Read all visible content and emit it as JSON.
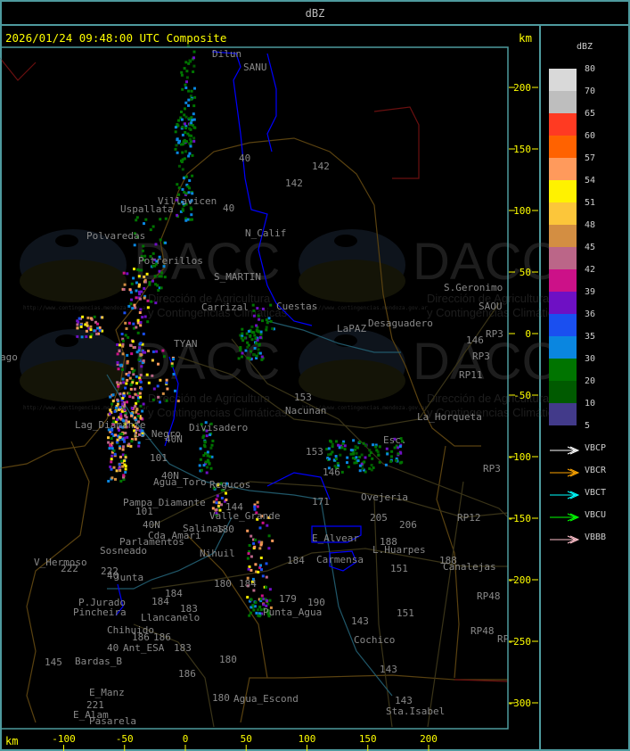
{
  "header": {
    "title": "dBZ"
  },
  "map": {
    "timestamp_title": "2026/01/24 09:48:00 UTC Composite",
    "unit_label_top": "km",
    "unit_label_bottom": "km",
    "x_axis_ticks": [
      "-100",
      "-50",
      "0",
      "50",
      "100",
      "150",
      "200"
    ],
    "y_axis_ticks": [
      "200",
      "150",
      "100",
      "50",
      "0",
      "-50",
      "-100",
      "-150",
      "-200",
      "-250",
      "-300"
    ],
    "place_labels": [
      "Dilun",
      "SANU",
      "40",
      "142",
      "142",
      "Villavicen",
      "40",
      "Uspallata",
      "N_Calif",
      "Polvaredas",
      "Potrerillos",
      "S_MARTIN",
      "Carrizal",
      "Cuestas",
      "LaPAZ",
      "Desaguadero",
      "S.Geronimo",
      "SAOU",
      "146",
      "RP3",
      "RP3",
      "RP11",
      "TYAN",
      "ago",
      "153",
      "Nacunan",
      "La_Horqueta",
      "Lag_Diamante",
      "Co_Negro",
      "Divisadero",
      "40N",
      "Esc.",
      "153",
      "146",
      "101",
      "40N",
      "Agua_Toro",
      "Regucos",
      "171",
      "Ovejeria",
      "205",
      "206",
      "Pampa_Diamante",
      "101",
      "144",
      "Valle_Grande",
      "40N",
      "Salinas",
      "180",
      "Cda_Amari",
      "Parlamentos",
      "Sosneado",
      "Nihuil",
      "E_Alvear",
      "188",
      "L.Huarpes",
      "Carmensa",
      "184",
      "188",
      "Canalejas",
      "RP12",
      "RP3",
      "V_Hermoso",
      "222",
      "222",
      "Junta",
      "40",
      "180",
      "184",
      "184",
      "190",
      "151",
      "P.Jurado",
      "Pincheira",
      "184",
      "Llancanelo",
      "183",
      "Punta_Agua",
      "179",
      "151",
      "RP48",
      "RP48",
      "RP",
      "Chihuido",
      "186",
      "186",
      "40",
      "Ant_ESA",
      "183",
      "143",
      "Cochico",
      "145",
      "Bardas_B",
      "180",
      "186",
      "143",
      "E_Manz",
      "221",
      "180",
      "Agua_Escond",
      "143",
      "Sta.Isabel",
      "E_Alam",
      "Pasarela"
    ],
    "watermark": {
      "brand": "DACC",
      "line1": "Dirección de Agricultura",
      "line2": "y Contingencias Climáticas",
      "url": "http://www.contingencias.mendoza.gov.ar"
    }
  },
  "legend": {
    "title": "dBZ",
    "scale": [
      {
        "value": "80",
        "color": "#d9d9d9"
      },
      {
        "value": "70",
        "color": "#bebebe"
      },
      {
        "value": "65",
        "color": "#ff3a22"
      },
      {
        "value": "60",
        "color": "#ff6200"
      },
      {
        "value": "57",
        "color": "#ff9a5c"
      },
      {
        "value": "54",
        "color": "#fff200"
      },
      {
        "value": "51",
        "color": "#fcc63a"
      },
      {
        "value": "48",
        "color": "#d38e42"
      },
      {
        "value": "45",
        "color": "#bb6688"
      },
      {
        "value": "42",
        "color": "#cc1188"
      },
      {
        "value": "39",
        "color": "#6e10c4"
      },
      {
        "value": "36",
        "color": "#1a4ff0"
      },
      {
        "value": "35",
        "color": "#0a86e0"
      },
      {
        "value": "30",
        "color": "#007400"
      },
      {
        "value": "20",
        "color": "#005a00"
      },
      {
        "value": "10",
        "color": "#423a8a"
      },
      {
        "value": "5",
        "color": null
      }
    ],
    "vectors": [
      {
        "label": "VBCP",
        "color": "#ffffff"
      },
      {
        "label": "VBCR",
        "color": "#ffa500"
      },
      {
        "label": "VBCT",
        "color": "#00ffff"
      },
      {
        "label": "VBCU",
        "color": "#00ff00"
      },
      {
        "label": "VBBB",
        "color": "#ffc0cb"
      }
    ]
  }
}
